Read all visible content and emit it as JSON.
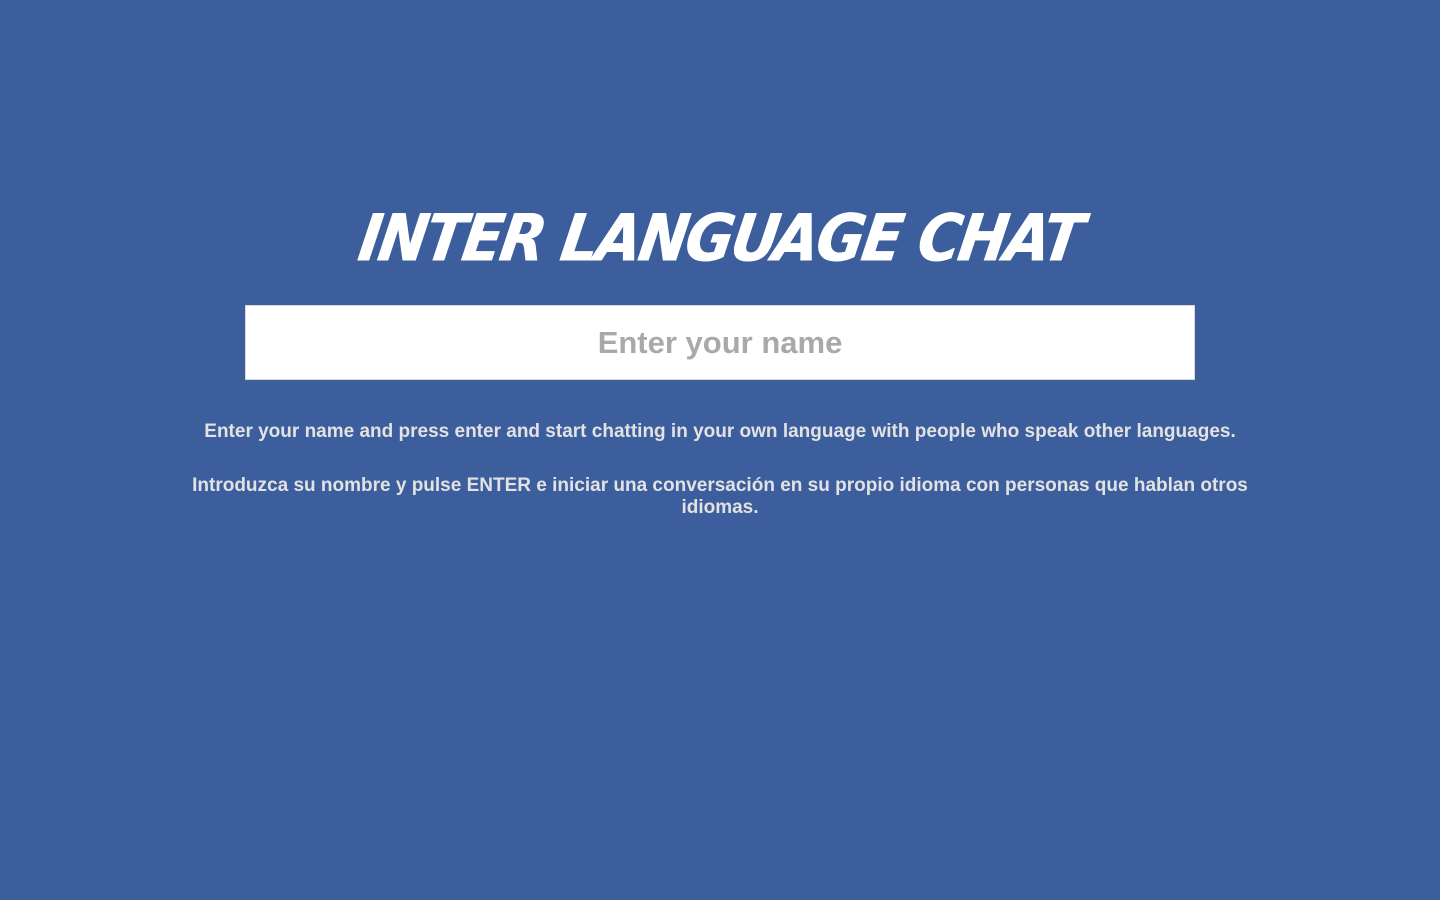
{
  "app": {
    "title": "Inter Language Chat"
  },
  "name_input": {
    "value": "",
    "placeholder": "Enter your name"
  },
  "instructions": {
    "english": "Enter your name and press enter and start chatting in your own language with people who speak other languages.",
    "spanish": "Introduzca su nombre y pulse ENTER e iniciar una conversación en su propio idioma con personas que hablan otros idiomas."
  },
  "colors": {
    "background": "#3c5e9c",
    "title": "#ffffff",
    "input_background": "#ffffff",
    "placeholder": "#a9a9a9",
    "text": "#e2e2e2"
  }
}
